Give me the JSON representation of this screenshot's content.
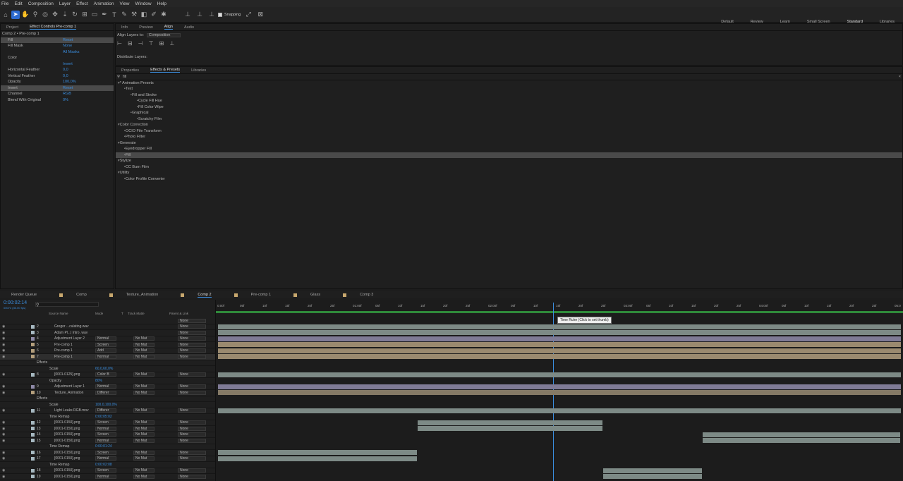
{
  "menu": [
    "File",
    "Edit",
    "Composition",
    "Layer",
    "Effect",
    "Animation",
    "View",
    "Window",
    "Help"
  ],
  "toolbar": {
    "snapping": "Snapping"
  },
  "workspaces": [
    "Default",
    "Review",
    "Learn",
    "Small Screen",
    "Standard",
    "Libraries"
  ],
  "effect_controls": {
    "tab_project": "Project",
    "tab_ec": "Effect Controls Pre-comp 1",
    "title": "Comp 2 • Pre-comp 1",
    "rows": [
      {
        "label": "Fill",
        "value": "Reset"
      },
      {
        "label": "Fill Mask",
        "value": "None"
      },
      {
        "label": "",
        "value": "All Masks"
      },
      {
        "label": "Color",
        "value": ""
      },
      {
        "label": "",
        "value": "Invert"
      },
      {
        "label": "Horizontal Feather",
        "value": "0,0"
      },
      {
        "label": "Vertical Feather",
        "value": "0,0"
      },
      {
        "label": "Opacity",
        "value": "100,0%"
      },
      {
        "label": "Invert",
        "value": "Reset"
      },
      {
        "label": "Channel",
        "value": "RGB"
      },
      {
        "label": "Blend With Original",
        "value": "0%"
      }
    ]
  },
  "align": {
    "tabs": [
      "Info",
      "Preview",
      "Align",
      "Audio"
    ],
    "align_to_label": "Align Layers to:",
    "align_to": "Composition",
    "distribute": "Distribute Layers:"
  },
  "effects": {
    "tabs": [
      "Properties",
      "Effects & Presets",
      "Libraries"
    ],
    "search": "fill",
    "items": [
      {
        "t": "* Animation Presets",
        "d": 0
      },
      {
        "t": "Text",
        "d": 1
      },
      {
        "t": "Fill and Stroke",
        "d": 2
      },
      {
        "t": "Cycle Fill Hue",
        "d": 3
      },
      {
        "t": "Fill Color Wipe",
        "d": 3
      },
      {
        "t": "Graphical",
        "d": 2
      },
      {
        "t": "Scratchy Film",
        "d": 3
      },
      {
        "t": "Color Correction",
        "d": 0
      },
      {
        "t": "OCIO File Transform",
        "d": 1
      },
      {
        "t": "Photo Filter",
        "d": 1
      },
      {
        "t": "Generate",
        "d": 0
      },
      {
        "t": "Eyedropper Fill",
        "d": 1
      },
      {
        "t": "Fill",
        "d": 1
      },
      {
        "t": "Stylize",
        "d": 0
      },
      {
        "t": "CC Burn Film",
        "d": 1
      },
      {
        "t": "Utility",
        "d": 0
      },
      {
        "t": "Color Profile Converter",
        "d": 1
      }
    ]
  },
  "timeline": {
    "tabs": [
      "Render Queue",
      "Comp",
      "Texture_Animation",
      "Comp 2",
      "Pre-comp 1",
      "Glass",
      "Comp 3"
    ],
    "timecode": "0:00:02:14",
    "fps": "00074 (30.00 fps)",
    "tooltip": "Time Ruler (Click to set thumb)",
    "headers": {
      "source": "Source Name",
      "mode": "Mode",
      "t": "T",
      "track": "Track Matte",
      "parent": "Parent & Link"
    },
    "ruler": [
      "0:00f",
      "05f",
      "10f",
      "15f",
      "20f",
      "25f",
      "01:00f",
      "05f",
      "10f",
      "15f",
      "20f",
      "25f",
      "02:00f",
      "05f",
      "10f",
      "15f",
      "20f",
      "25f",
      "03:00f",
      "05f",
      "10f",
      "15f",
      "20f",
      "25f",
      "04:00f",
      "05f",
      "10f",
      "15f",
      "20f",
      "25f",
      "05:0"
    ],
    "layers": [
      {
        "n": "",
        "name": "",
        "mode": "",
        "matte": "",
        "parent": "None"
      },
      {
        "n": "2",
        "name": "Gregor ...culating.wav",
        "mode": "",
        "matte": "",
        "parent": "None"
      },
      {
        "n": "3",
        "name": "Adam Pl...l Intro .wav",
        "mode": "",
        "matte": "",
        "parent": "None"
      },
      {
        "n": "4",
        "name": "Adjustment Layer 2",
        "mode": "Normal",
        "matte": "No Mat",
        "parent": "None"
      },
      {
        "n": "5",
        "name": "Pre-comp 1",
        "mode": "Screen",
        "matte": "No Mat",
        "parent": "None"
      },
      {
        "n": "6",
        "name": "Pre-comp 1",
        "mode": "Add",
        "matte": "No Mat",
        "parent": "None"
      },
      {
        "n": "7",
        "name": "Pre-comp 1",
        "mode": "Normal",
        "matte": "No Mat",
        "parent": "None"
      },
      {
        "n": "",
        "name": "Effects",
        "mode": "",
        "matte": "",
        "parent": ""
      },
      {
        "n": "",
        "name": "Scale",
        "mode": "60,0,60,0%",
        "matte": "",
        "parent": ""
      },
      {
        "n": "8",
        "name": "[0001-0125].png",
        "mode": "Color B",
        "matte": "No Mat",
        "parent": "None"
      },
      {
        "n": "",
        "name": "Opacity",
        "mode": "80%",
        "matte": "",
        "parent": ""
      },
      {
        "n": "9",
        "name": "Adjustment Layer 1",
        "mode": "Normal",
        "matte": "No Mat",
        "parent": "None"
      },
      {
        "n": "10",
        "name": "Texture_Animation",
        "mode": "Differer",
        "matte": "No Mat",
        "parent": "None"
      },
      {
        "n": "",
        "name": "Effects",
        "mode": "",
        "matte": "",
        "parent": ""
      },
      {
        "n": "",
        "name": "Scale",
        "mode": "100,0,100,0%",
        "matte": "",
        "parent": ""
      },
      {
        "n": "11",
        "name": "Light Leaks RGB.mov",
        "mode": "Differer",
        "matte": "No Mat",
        "parent": "None"
      },
      {
        "n": "",
        "name": "Time Remap",
        "mode": "0:00:05:02",
        "matte": "",
        "parent": ""
      },
      {
        "n": "12",
        "name": "[0001-0150].png",
        "mode": "Screen",
        "matte": "No Mat",
        "parent": "None"
      },
      {
        "n": "13",
        "name": "[0001-0150].png",
        "mode": "Normal",
        "matte": "No Mat",
        "parent": "None"
      },
      {
        "n": "14",
        "name": "[0001-0150].png",
        "mode": "Screen",
        "matte": "No Mat",
        "parent": "None"
      },
      {
        "n": "15",
        "name": "[0001-0150].png",
        "mode": "Normal",
        "matte": "No Mat",
        "parent": "None"
      },
      {
        "n": "",
        "name": "Time Remap",
        "mode": "0:00:01:24",
        "matte": "",
        "parent": ""
      },
      {
        "n": "16",
        "name": "[0001-0150].png",
        "mode": "Screen",
        "matte": "No Mat",
        "parent": "None"
      },
      {
        "n": "17",
        "name": "[0001-0150].png",
        "mode": "Normal",
        "matte": "No Mat",
        "parent": "None"
      },
      {
        "n": "",
        "name": "Time Remap",
        "mode": "0:00:02:08",
        "matte": "",
        "parent": ""
      },
      {
        "n": "18",
        "name": "[0001-0150].png",
        "mode": "Screen",
        "matte": "No Mat",
        "parent": "None"
      },
      {
        "n": "19",
        "name": "[0001-0150].png",
        "mode": "Normal",
        "matte": "No Mat",
        "parent": "None"
      }
    ]
  }
}
